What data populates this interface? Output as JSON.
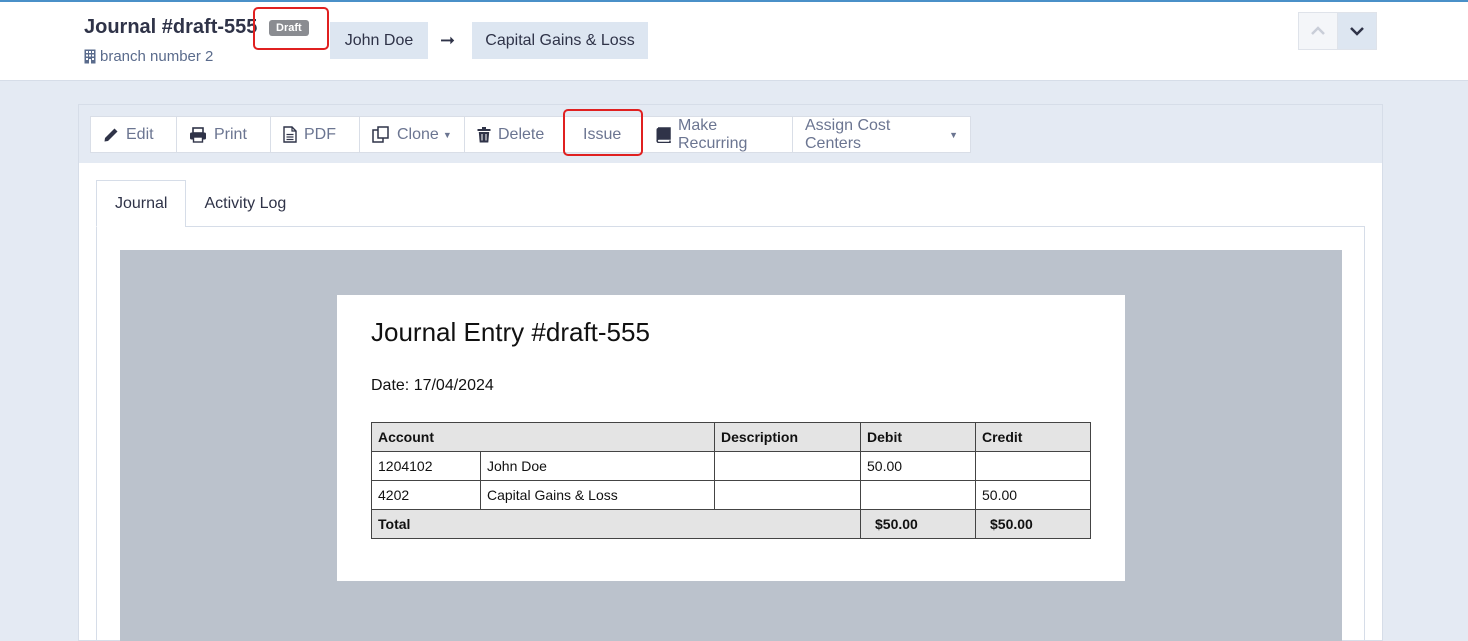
{
  "header": {
    "title": "Journal #draft-555",
    "status_badge": "Draft",
    "branch": "branch number 2",
    "from_account": "John Doe",
    "arrow": "➞",
    "to_account": "Capital Gains & Loss"
  },
  "toolbar": {
    "edit": "Edit",
    "print": "Print",
    "pdf": "PDF",
    "clone": "Clone",
    "delete": "Delete",
    "issue": "Issue",
    "make_recurring": "Make Recurring",
    "assign_cost_centers": "Assign Cost Centers"
  },
  "tabs": {
    "journal": "Journal",
    "activity_log": "Activity Log"
  },
  "document": {
    "title": "Journal Entry #draft-555",
    "date": "Date: 17/04/2024",
    "columns": {
      "account": "Account",
      "description": "Description",
      "debit": "Debit",
      "credit": "Credit"
    },
    "rows": [
      {
        "code": "1204102",
        "name": "John Doe",
        "description": "",
        "debit": "50.00",
        "credit": ""
      },
      {
        "code": "4202",
        "name": "Capital Gains & Loss",
        "description": "",
        "debit": "",
        "credit": "50.00"
      }
    ],
    "total_label": "Total",
    "total_debit": "$50.00",
    "total_credit": "$50.00"
  }
}
